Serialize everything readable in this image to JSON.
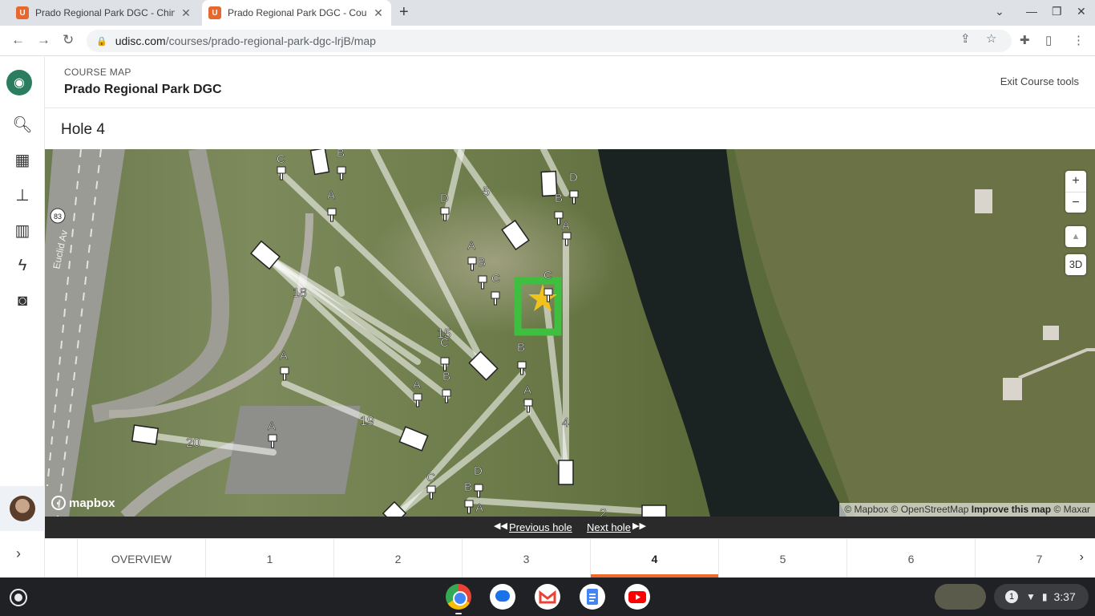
{
  "browser": {
    "tabs": [
      {
        "title": "Prado Regional Park DGC - Chino",
        "favicon": "U"
      },
      {
        "title": "Prado Regional Park DGC - Course",
        "favicon": "U",
        "active": true
      }
    ],
    "url_host": "udisc.com",
    "url_path": "/courses/prado-regional-park-dgc-lrjB/map"
  },
  "header": {
    "crumb": "COURSE MAP",
    "course_name": "Prado Regional Park DGC",
    "exit_label": "Exit Course tools"
  },
  "hole_title": "Hole 4",
  "map": {
    "zoom_in": "+",
    "zoom_out": "−",
    "three_d": "3D",
    "compass": "▲",
    "logo_text": "mapbox",
    "road_badge": "83",
    "road_name": "Euclid Av",
    "attribution": {
      "mapbox": "© Mapbox",
      "osm": "© OpenStreetMap",
      "improve": "Improve this map",
      "maxar": "© Maxar"
    },
    "hole_numbers": [
      "5",
      "18",
      "15",
      "19",
      "20",
      "4",
      "2"
    ],
    "pin_letters": [
      "A",
      "B",
      "C",
      "D"
    ]
  },
  "hole_nav": {
    "prev": "Previous hole",
    "next": "Next hole"
  },
  "tabs": [
    "OVERVIEW",
    "1",
    "2",
    "3",
    "4",
    "5",
    "6",
    "7"
  ],
  "active_tab_index": 4,
  "system": {
    "time": "3:37",
    "notification_count": "1"
  },
  "colors": {
    "accent": "#f06b2b",
    "udisc_green": "#2a7d5f",
    "target_green": "#3fbf3f",
    "star": "#f2c21b"
  }
}
